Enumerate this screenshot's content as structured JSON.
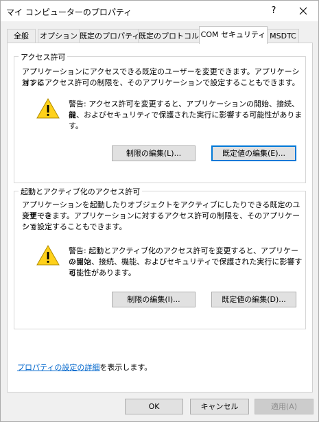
{
  "window": {
    "title": "マイ コンピューターのプロパティ",
    "help": "?"
  },
  "tabs": [
    {
      "label": "全般",
      "active": false
    },
    {
      "label": "オプション",
      "active": false
    },
    {
      "label": "既定のプロパティ",
      "active": false
    },
    {
      "label": "既定のプロトコル",
      "active": false
    },
    {
      "label": "COM セキュリティ",
      "active": true
    },
    {
      "label": "MSDTC",
      "active": false
    }
  ],
  "access": {
    "title": "アクセス許可",
    "desc_line1": "アプリケーションにアクセスできる既定のユーザーを変更できます。アプリケーションに",
    "desc_line2": "対するアクセス許可の制限を、そのアプリケーションで設定することもできます。",
    "warn_line1": "警告: アクセス許可を変更すると、アプリケーションの開始、接続、機",
    "warn_line2": "能、およびセキュリティで保護された実行に影響する可能性があります。",
    "edit_limits": "制限の編集(L)...",
    "edit_default": "既定値の編集(E)..."
  },
  "launch": {
    "title": "起動とアクティブ化のアクセス許可",
    "desc_line1": "アプリケーションを起動したりオブジェクトをアクティブにしたりできる既定のユーザーを",
    "desc_line2": "変更できます。アプリケーションに対するアクセス許可の制限を、そのアプリケーショ",
    "desc_line3": "ンで設定することもできます。",
    "warn_line1": "警告: 起動とアクティブ化のアクセス許可を変更すると、アプリケーション",
    "warn_line2": "の開始、接続、機能、およびセキュリティで保護された実行に影響する",
    "warn_line3": "可能性があります。",
    "edit_limits": "制限の編集(I)...",
    "edit_default": "既定値の編集(D)..."
  },
  "details": {
    "link": "プロパティの設定の詳細",
    "suffix": "を表示します。"
  },
  "footer": {
    "ok": "OK",
    "cancel": "キャンセル",
    "apply": "適用(A)"
  },
  "colors": {
    "accent": "#0078d7",
    "link": "#0066cc",
    "warning": "#ffd11a"
  }
}
